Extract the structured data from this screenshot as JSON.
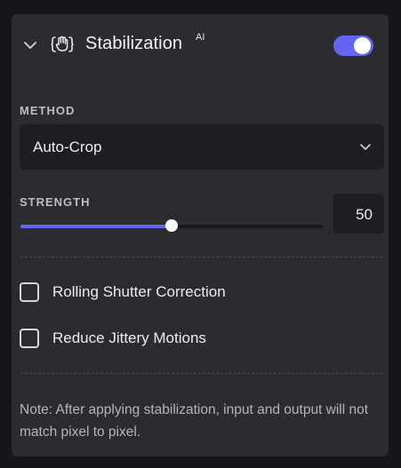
{
  "panel": {
    "title": "Stabilization",
    "ai_badge": "AI",
    "enabled": true,
    "icons": {
      "collapse": "chevron-down-icon",
      "feature": "stabilization-hand-icon"
    },
    "accent_color": "#6366f1"
  },
  "method": {
    "label": "METHOD",
    "selected": "Auto-Crop"
  },
  "strength": {
    "label": "STRENGTH",
    "value": "50",
    "fraction": 0.5
  },
  "options": [
    {
      "label": "Rolling Shutter Correction",
      "checked": false
    },
    {
      "label": "Reduce Jittery Motions",
      "checked": false
    }
  ],
  "note": "Note: After applying stabilization, input and output will not match pixel to pixel."
}
